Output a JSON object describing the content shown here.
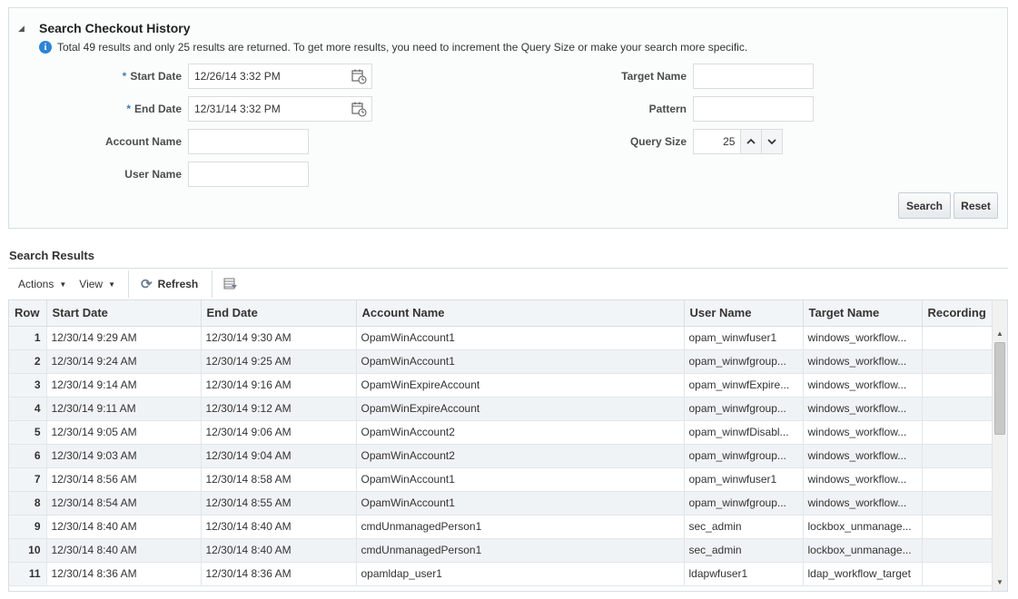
{
  "search": {
    "title": "Search Checkout History",
    "info": "Total 49 results and only 25 results are returned. To get more results, you need to increment the Query Size or make your search more specific.",
    "start_date_label": "Start Date",
    "start_date_value": "12/26/14 3:32 PM",
    "end_date_label": "End Date",
    "end_date_value": "12/31/14 3:32 PM",
    "account_name_label": "Account Name",
    "account_name_value": "",
    "user_name_label": "User Name",
    "user_name_value": "",
    "target_name_label": "Target Name",
    "target_name_value": "",
    "pattern_label": "Pattern",
    "pattern_value": "",
    "query_size_label": "Query Size",
    "query_size_value": "25",
    "search_button": "Search",
    "reset_button": "Reset",
    "required_marker": "*"
  },
  "results": {
    "title": "Search Results",
    "toolbar": {
      "actions": "Actions",
      "view": "View",
      "refresh": "Refresh"
    },
    "columns": [
      "Row",
      "Start Date",
      "End Date",
      "Account Name",
      "User Name",
      "Target Name",
      "Recording"
    ],
    "rows": [
      [
        "1",
        "12/30/14 9:29 AM",
        "12/30/14 9:30 AM",
        "OpamWinAccount1",
        "opam_winwfuser1",
        "windows_workflow...",
        ""
      ],
      [
        "2",
        "12/30/14 9:24 AM",
        "12/30/14 9:25 AM",
        "OpamWinAccount1",
        "opam_winwfgroup...",
        "windows_workflow...",
        ""
      ],
      [
        "3",
        "12/30/14 9:14 AM",
        "12/30/14 9:16 AM",
        "OpamWinExpireAccount",
        "opam_winwfExpire...",
        "windows_workflow...",
        ""
      ],
      [
        "4",
        "12/30/14 9:11 AM",
        "12/30/14 9:12 AM",
        "OpamWinExpireAccount",
        "opam_winwfgroup...",
        "windows_workflow...",
        ""
      ],
      [
        "5",
        "12/30/14 9:05 AM",
        "12/30/14 9:06 AM",
        "OpamWinAccount2",
        "opam_winwfDisabl...",
        "windows_workflow...",
        ""
      ],
      [
        "6",
        "12/30/14 9:03 AM",
        "12/30/14 9:04 AM",
        "OpamWinAccount2",
        "opam_winwfgroup...",
        "windows_workflow...",
        ""
      ],
      [
        "7",
        "12/30/14 8:56 AM",
        "12/30/14 8:58 AM",
        "OpamWinAccount1",
        "opam_winwfuser1",
        "windows_workflow...",
        ""
      ],
      [
        "8",
        "12/30/14 8:54 AM",
        "12/30/14 8:55 AM",
        "OpamWinAccount1",
        "opam_winwfgroup...",
        "windows_workflow...",
        ""
      ],
      [
        "9",
        "12/30/14 8:40 AM",
        "12/30/14 8:40 AM",
        "cmdUnmanagedPerson1",
        "sec_admin",
        "lockbox_unmanage...",
        ""
      ],
      [
        "10",
        "12/30/14 8:40 AM",
        "12/30/14 8:40 AM",
        "cmdUnmanagedPerson1",
        "sec_admin",
        "lockbox_unmanage...",
        ""
      ],
      [
        "11",
        "12/30/14 8:36 AM",
        "12/30/14 8:36 AM",
        "opamldap_user1",
        "ldapwfuser1",
        "ldap_workflow_target",
        ""
      ]
    ]
  },
  "icons": {
    "collapse": "collapse-triangle-icon",
    "info": "info-icon",
    "calendar": "calendar-icon",
    "refresh": "refresh-icon",
    "detach": "detach-table-icon"
  },
  "colors": {
    "accent": "#2c84d6",
    "border": "#d6dfe6",
    "header_bg": "#f2f5f7",
    "alt_row": "#f0f3f5"
  }
}
